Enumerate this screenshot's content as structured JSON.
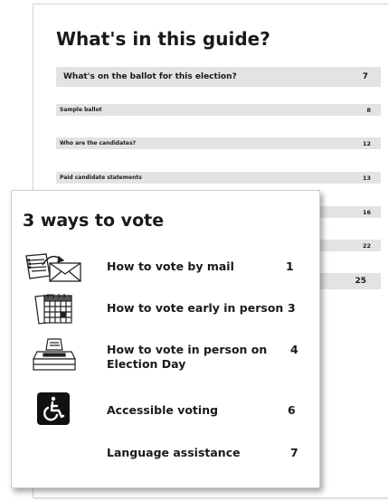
{
  "guide": {
    "title": "What's in this guide?",
    "toc": [
      {
        "label": "What's on the ballot for this election?",
        "page": "7"
      },
      {
        "label": "Sample ballot",
        "page": "8"
      },
      {
        "label": "Who are the candidates?",
        "page": "12"
      },
      {
        "label": "Paid candidate statements",
        "page": "13"
      },
      {
        "page": "16"
      },
      {
        "page": "22"
      },
      {
        "page": "25"
      }
    ]
  },
  "ways_to_vote": {
    "title": "3 ways to vote",
    "items": [
      {
        "label": "How to vote by mail",
        "page": "1",
        "icon": "mail-ballot-icon"
      },
      {
        "label": "How to vote early in person",
        "page": "3",
        "icon": "calendar-icon"
      },
      {
        "label": "How to vote in person on Election Day",
        "page": "4",
        "icon": "ballot-box-icon"
      },
      {
        "label": "Accessible voting",
        "page": "6",
        "icon": "accessibility-icon"
      },
      {
        "label": "Language assistance",
        "page": "7",
        "icon": ""
      }
    ]
  },
  "colors": {
    "row_background": "#e3e3e3",
    "text": "#1a1a1a",
    "accessibility_icon_bg": "#111111"
  }
}
